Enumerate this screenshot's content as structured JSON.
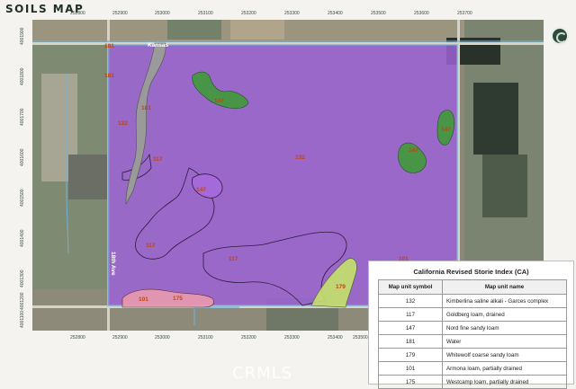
{
  "title": "SOILS MAP",
  "roads": {
    "kansas": "Kansas",
    "avenue": "18th Ave"
  },
  "unit_labels": {
    "u181a": "181",
    "u181b": "181",
    "u181c": "181",
    "u132a": "132",
    "u132b": "132",
    "u147a": "147",
    "u147b": "147",
    "u147c": "147",
    "u147d": "147",
    "u117a": "117",
    "u117b": "117",
    "u117c": "117",
    "u101a": "101",
    "u101b": "101",
    "u175": "175",
    "u179": "179"
  },
  "ticks": {
    "left": [
      "4001900",
      "4001800",
      "4001700",
      "4001600",
      "4001500",
      "4001400",
      "4001300",
      "4001200",
      "4001100"
    ],
    "top": [
      "252800",
      "252900",
      "253000",
      "253100",
      "253200",
      "253300",
      "253400",
      "253500",
      "253600",
      "253700"
    ],
    "bottom": [
      "252800",
      "252900",
      "253000",
      "253100",
      "253200",
      "253300",
      "253400",
      "253500"
    ]
  },
  "legend": {
    "title": "California Revised Storie Index (CA)",
    "col_symbol": "Map unit symbol",
    "col_name": "Map unit name",
    "rows": [
      {
        "symbol": "132",
        "name": "Kimberlina saline alkali - Garces complex"
      },
      {
        "symbol": "117",
        "name": "Goldberg loam, drained"
      },
      {
        "symbol": "147",
        "name": "Nord fine sandy loam"
      },
      {
        "symbol": "181",
        "name": "Water"
      },
      {
        "symbol": "179",
        "name": "Whitewolf coarse sandy loam"
      },
      {
        "symbol": "101",
        "name": "Armona loam, partially drained"
      },
      {
        "symbol": "175",
        "name": "Westcamp loam, partially drained"
      }
    ]
  },
  "watermark": "CRMLS",
  "colors": {
    "purple": "#9c63d6",
    "green": "#3f9a3a",
    "gray": "#9a9a9a",
    "pink": "#e99aae",
    "yellowgreen": "#c4e26b",
    "label": "#c1440e"
  }
}
